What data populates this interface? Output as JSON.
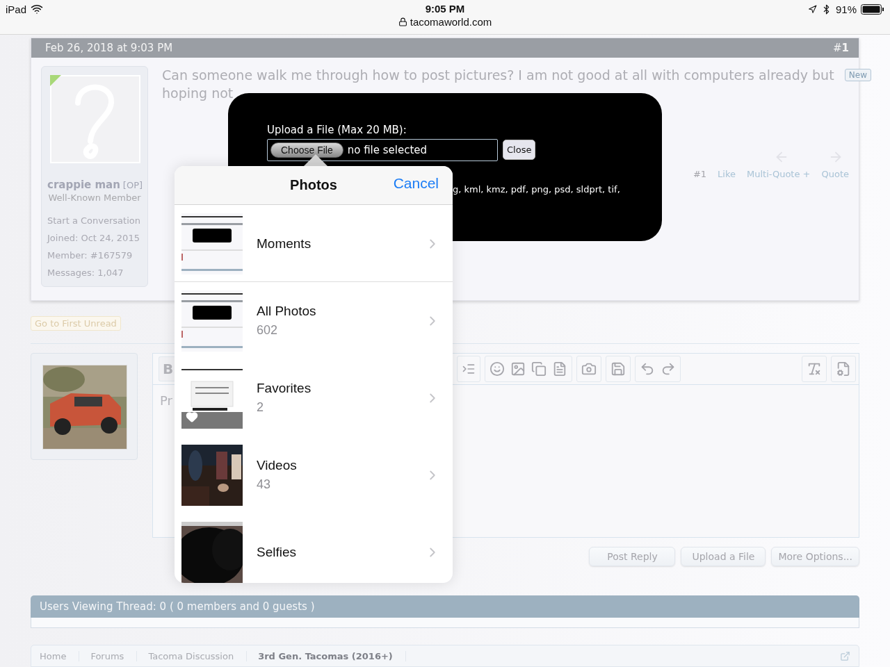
{
  "status_bar": {
    "device": "iPad",
    "time": "9:05 PM",
    "url": "tacomaworld.com",
    "battery": "91%"
  },
  "post": {
    "date": "Feb 26, 2018 at 9:03 PM",
    "number": "#**1**",
    "badge": "New",
    "author": {
      "name": "crappie man",
      "tag": "[OP]",
      "title": "Well-Known Member",
      "link": "Start a Conversation",
      "stats": [
        {
          "label": "Joined:",
          "value": "Oct 24, 2015"
        },
        {
          "label": "Member:",
          "value": "#167579"
        },
        {
          "label": "Messages:",
          "value": "1,047"
        }
      ]
    },
    "message": [
      "Can someone walk me through how to post pictures? I am not good at all with computers already but",
      "hoping not"
    ],
    "actions": [
      {
        "label": "#1",
        "kind": "text"
      },
      {
        "label": "Like",
        "kind": "link"
      },
      {
        "label": "Multi-Quote +",
        "kind": "link"
      },
      {
        "label": "Quote",
        "kind": "link"
      }
    ]
  },
  "go_to_first_unread": "Go to First Unread",
  "editor": {
    "bold_button": "B",
    "placeholder": "Pr",
    "buttons": [
      "Post Reply",
      "Upload a File",
      "More Options..."
    ]
  },
  "users_viewing": "Users Viewing Thread: 0 ( 0 members and 0 guests )",
  "breadcrumb": [
    {
      "label": "Home",
      "current": false
    },
    {
      "label": "Forums",
      "current": false
    },
    {
      "label": "Tacoma Discussion",
      "current": false
    },
    {
      "label": "3rd Gen. Tacomas (2016+)",
      "current": true
    }
  ],
  "upload_dialog": {
    "label": "Upload a File (Max 20 MB):",
    "choose_button": "Choose File",
    "file_status": "no file selected",
    "close_button": "Close",
    "allowed_types": "g, kml, kmz, pdf, png, psd, sldprt, tif,"
  },
  "photos_picker": {
    "title": "Photos",
    "cancel": "Cancel",
    "albums": [
      {
        "name": "Moments",
        "kind": "screenshot",
        "favorite": false
      },
      {
        "name": "All Photos",
        "count": "602",
        "kind": "screenshot",
        "favorite": false
      },
      {
        "name": "Favorites",
        "count": "2",
        "kind": "document",
        "favorite": true
      },
      {
        "name": "Videos",
        "count": "43",
        "kind": "crowd",
        "favorite": false
      },
      {
        "name": "Selfies",
        "kind": "redacted",
        "favorite": false
      }
    ]
  }
}
